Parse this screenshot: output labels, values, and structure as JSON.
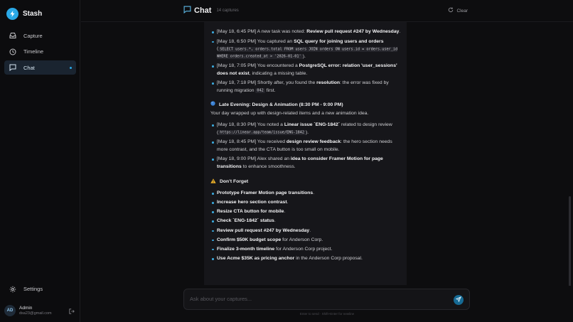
{
  "app": {
    "name": "Stash"
  },
  "sidebar": {
    "items": [
      {
        "label": "Capture",
        "icon": "inbox-icon"
      },
      {
        "label": "Timeline",
        "icon": "clock-icon"
      },
      {
        "label": "Chat",
        "icon": "chat-icon",
        "active": true
      }
    ],
    "settings_label": "Settings",
    "user": {
      "initials": "AD",
      "name": "Admin",
      "email": "dsa23@gmail.com"
    }
  },
  "header": {
    "title": "Chat",
    "count": "14 captures",
    "clear_label": "Clear"
  },
  "chat": {
    "block1": [
      {
        "a": "[May 18, 6:45 PM] A new task was noted: ",
        "b": "Review pull request #247 by Wednesday",
        "c": "."
      },
      {
        "a": "[May 18, 6:50 PM] You captured an ",
        "b": "SQL query for joining users and orders",
        "c": " (",
        "code": "SELECT users.*, orders.total FROM users JOIN orders ON users.id = orders.user_id WHERE orders.created_at > '2026-01-01'",
        "d": ")."
      },
      {
        "a": "[May 18, 7:05 PM] You encountered a ",
        "b": "PostgreSQL error: relation 'user_sessions' does not exist",
        "c": ", indicating a missing table."
      },
      {
        "a": "[May 18, 7:18 PM] Shortly after, you found the ",
        "b": "resolution",
        "c": ": the error was fixed by running migration ",
        "code": "042",
        "d": " first."
      }
    ],
    "section2_emoji": "🔵",
    "section2_title": "Late Evening: Design & Animation (8:30 PM - 9:00 PM)",
    "section2_intro": "Your day wrapped up with design-related items and a new animation idea.",
    "block2": [
      {
        "a": "[May 18, 8:30 PM] You noted a ",
        "b": "Linear issue `ENG-1842`",
        "c": " related to design review (",
        "code": "https://linear.app/team/issue/ENG-1842",
        "d": ")."
      },
      {
        "a": "[May 18, 8:45 PM] You received ",
        "b": "design review feedback",
        "c": ": the hero section needs more contrast, and the CTA button is too small on mobile."
      },
      {
        "a": "[May 18, 9:00 PM] Alex shared an ",
        "b": "idea to consider Framer Motion for page transitions",
        "c": " to enhance smoothness."
      }
    ],
    "dontforget_emoji": "⚠",
    "dontforget_title": "Don't Forget",
    "dontforget": [
      {
        "b": "Prototype Framer Motion page transitions",
        "c": "."
      },
      {
        "b": "Increase hero section contrast",
        "c": "."
      },
      {
        "b": "Resize CTA button for mobile",
        "c": "."
      },
      {
        "b": "Check `ENG-1842` status",
        "c": "."
      },
      {
        "b": "Review pull request #247 by Wednesday",
        "c": "."
      },
      {
        "b": "Confirm $50K budget scope",
        "c": " for Anderson Corp."
      },
      {
        "b": "Finalize 3-month timeline",
        "c": " for Anderson Corp project."
      },
      {
        "b": "Use Acme $35K as pricing anchor",
        "c": " in the Anderson Corp proposal."
      }
    ]
  },
  "input": {
    "placeholder": "Ask about your captures...",
    "hint": "Enter to send · Shift+Enter for newline"
  },
  "colors": {
    "accent": "#2aa8e6",
    "background": "#0d0d0f",
    "panel": "#16161a"
  }
}
